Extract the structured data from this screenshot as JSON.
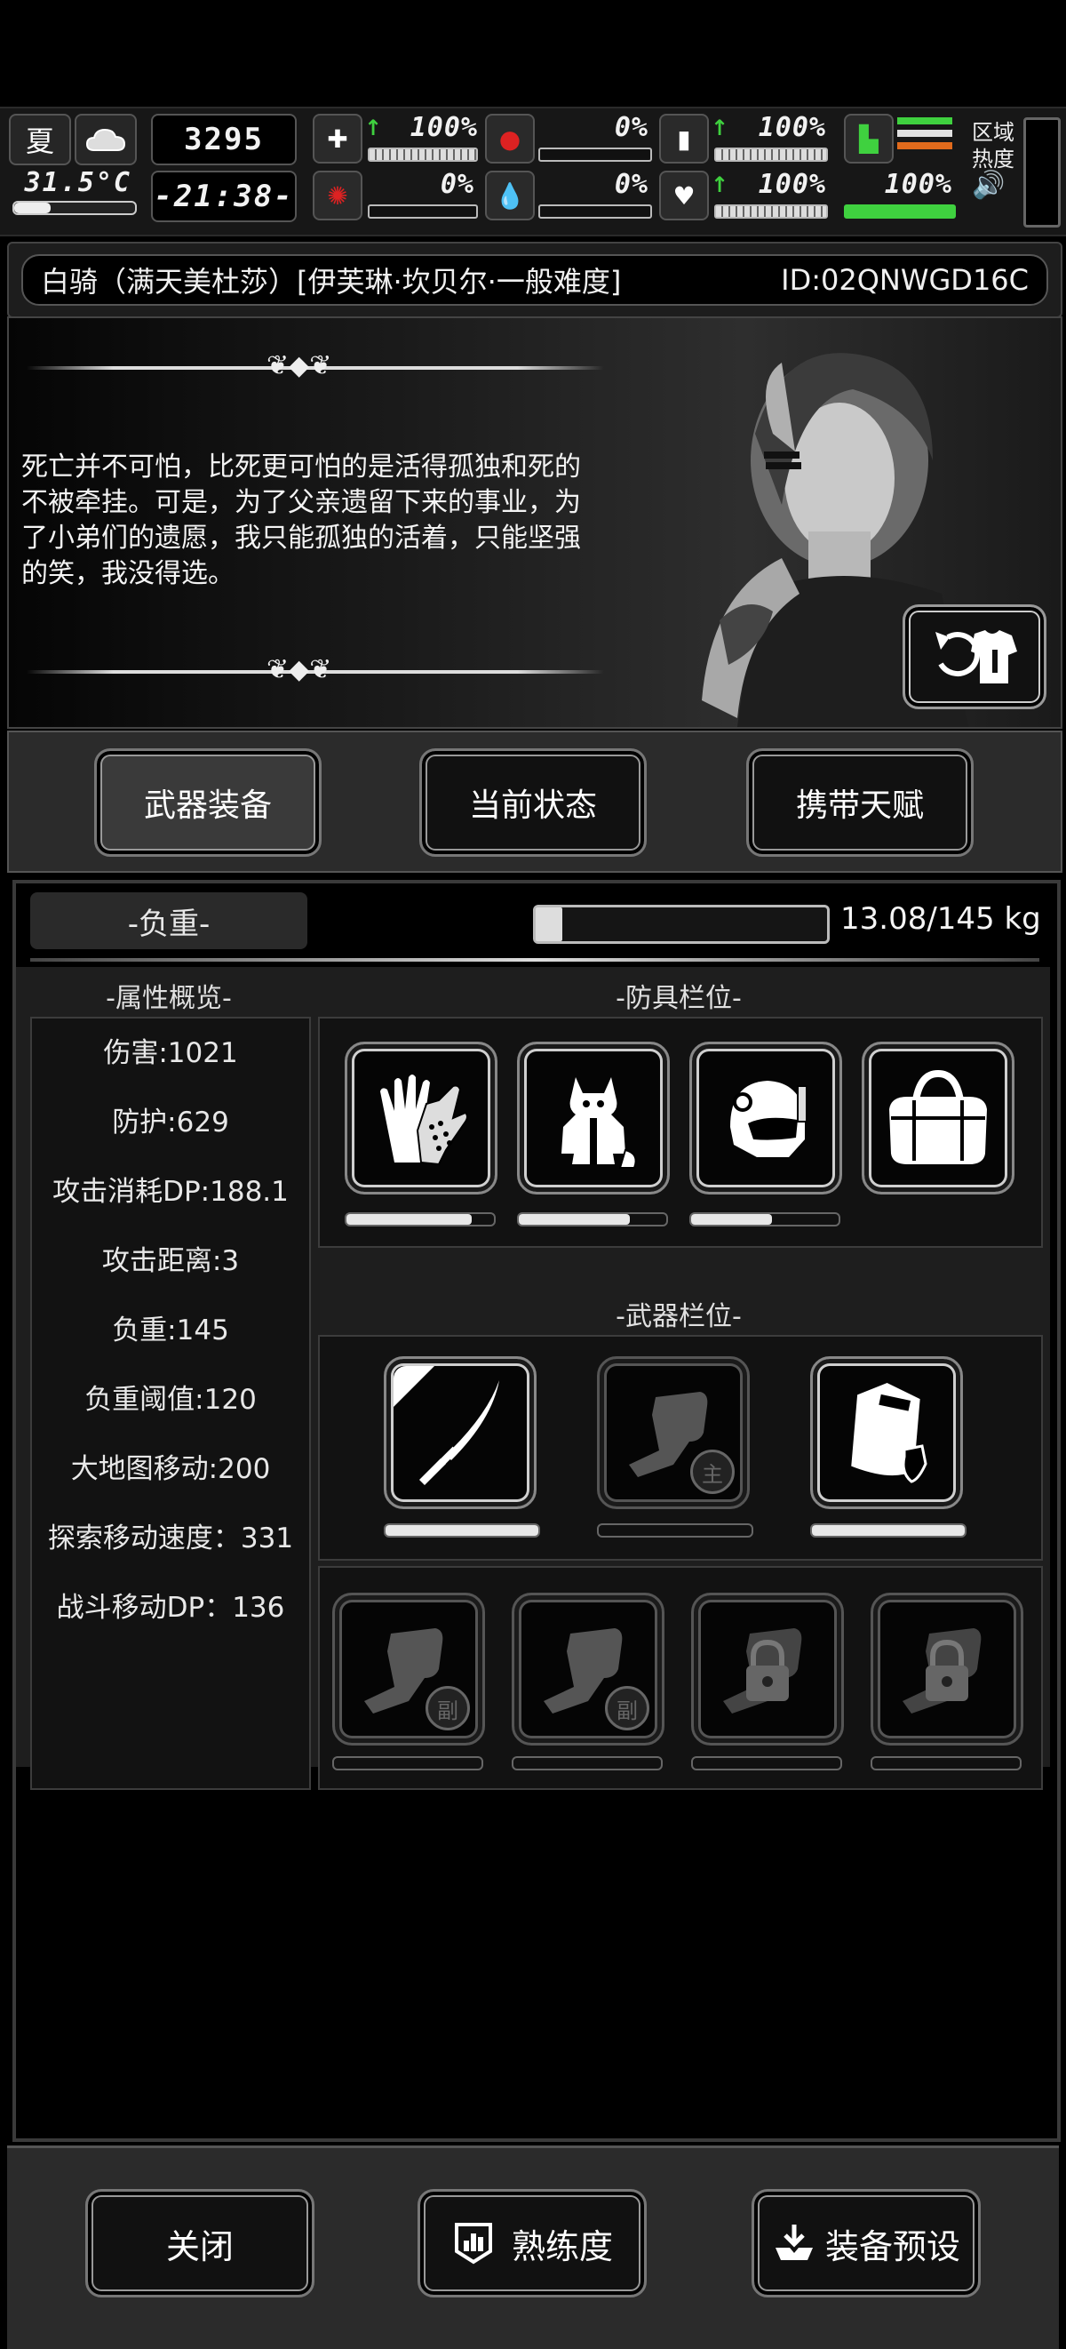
{
  "status": {
    "season": "夏",
    "temperature": "31.5°C",
    "days": "3295",
    "time": "-21:38-",
    "stats": [
      {
        "icon": "medkit-icon",
        "value": "100%"
      },
      {
        "icon": "stomach-icon",
        "value": "0%"
      },
      {
        "icon": "water-icon",
        "value": "100%"
      },
      {
        "icon": "stamina-icon",
        "value": "100%"
      },
      {
        "icon": "brain-icon",
        "value": "0%"
      },
      {
        "icon": "blood-icon",
        "value": "0%"
      },
      {
        "icon": "heart-icon",
        "value": "100%"
      },
      {
        "icon": "mood-icon",
        "value": "100%"
      }
    ],
    "heat_label_1": "区域",
    "heat_label_2": "热度"
  },
  "title": {
    "name": "白骑（满天美杜莎）[伊芙琳·坎贝尔·一般难度]",
    "id": "ID:02QNWGD16C"
  },
  "quote": "死亡并不可怕，比死更可怕的是活得孤独和死的不被牵挂。可是，为了父亲遗留下来的事业，为了小弟们的遗愿，我只能孤独的活着，只能坚强的笑，我没得选。",
  "tabs": [
    "武器装备",
    "当前状态",
    "携带天赋"
  ],
  "load": {
    "label": "-负重-",
    "text": "13.08/145 kg",
    "fraction": 0.09
  },
  "attributes": {
    "heading": "-属性概览-",
    "items": [
      "伤害:1021",
      "防护:629",
      "攻击消耗DP:188.1",
      "攻击距离:3",
      "负重:145",
      "负重阈值:120",
      "大地图移动:200",
      "探索移动速度：331",
      "战斗移动DP：136"
    ]
  },
  "armor": {
    "heading": "-防具栏位-",
    "slots": [
      {
        "icon": "gloves-icon",
        "durability": 0.85
      },
      {
        "icon": "fox-hoodie-icon",
        "durability": 0.75
      },
      {
        "icon": "helmet-icon",
        "durability": 0.55
      },
      {
        "icon": "duffel-bag-icon",
        "durability": null
      }
    ]
  },
  "weapons": {
    "heading": "-武器栏位-",
    "slots": [
      {
        "icon": "katana-icon",
        "durability": 1.0
      },
      {
        "icon": "fist-icon",
        "badge": "主",
        "durability": 0
      },
      {
        "icon": "shield-case-icon",
        "durability": 1.0
      }
    ],
    "extra": [
      {
        "icon": "fist-icon",
        "badge": "副"
      },
      {
        "icon": "fist-icon",
        "badge": "副"
      },
      {
        "icon": "lock-icon"
      },
      {
        "icon": "lock-icon"
      }
    ]
  },
  "bottom": [
    "关闭",
    "熟练度",
    "装备预设"
  ]
}
